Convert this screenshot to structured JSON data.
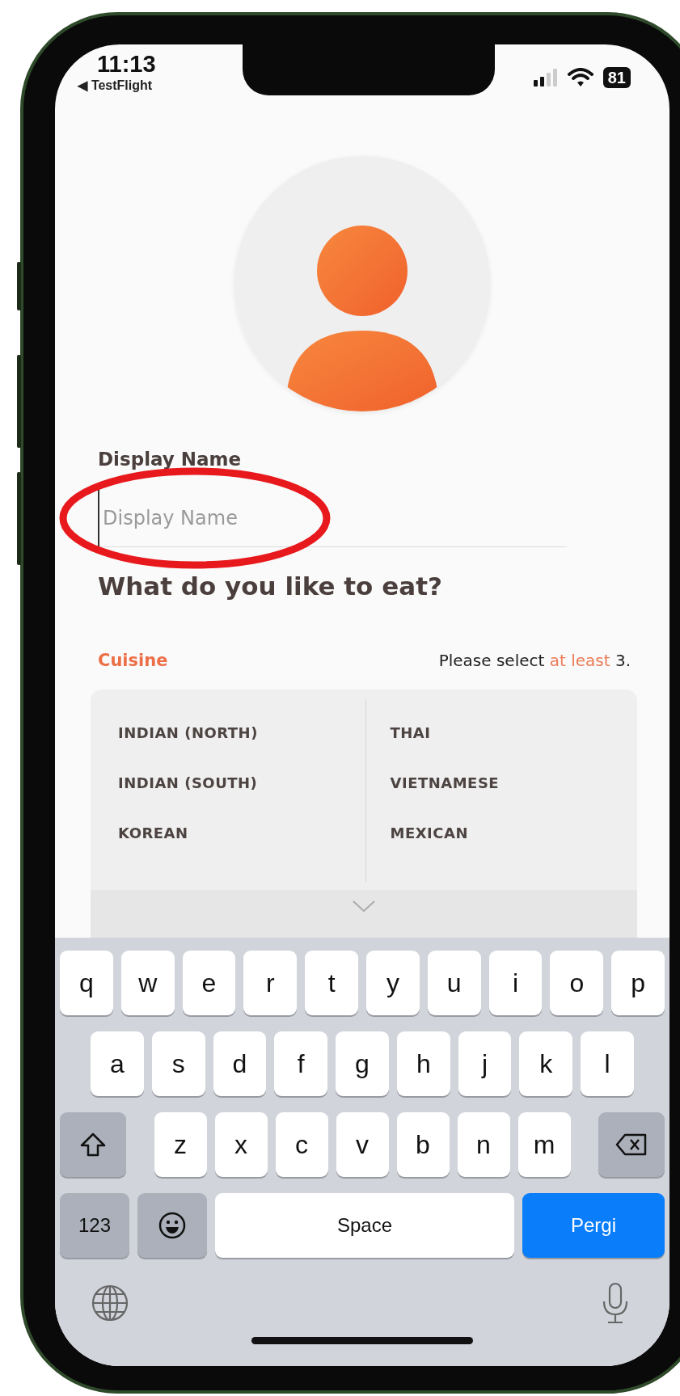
{
  "status_bar": {
    "time": "11:13",
    "back_label": "◀ TestFlight",
    "battery": "81"
  },
  "display_name": {
    "label": "Display Name",
    "placeholder": "Display Name"
  },
  "heading": "What do you like to eat?",
  "cuisine": {
    "title": "Cuisine",
    "hint_before": "Please select",
    "hint_emphasis": "at least",
    "hint_after": "3.",
    "columns": [
      [
        "INDIAN (NORTH)",
        "INDIAN (SOUTH)",
        "KOREAN"
      ],
      [
        "THAI",
        "VIETNAMESE",
        "MEXICAN"
      ]
    ]
  },
  "keyboard": {
    "rows": [
      [
        "q",
        "w",
        "e",
        "r",
        "t",
        "y",
        "u",
        "i",
        "o",
        "p"
      ],
      [
        "a",
        "s",
        "d",
        "f",
        "g",
        "h",
        "j",
        "k",
        "l"
      ],
      [
        "z",
        "x",
        "c",
        "v",
        "b",
        "n",
        "m"
      ]
    ],
    "numbers_key": "123",
    "space_key": "Space",
    "return_key": "Pergi"
  }
}
